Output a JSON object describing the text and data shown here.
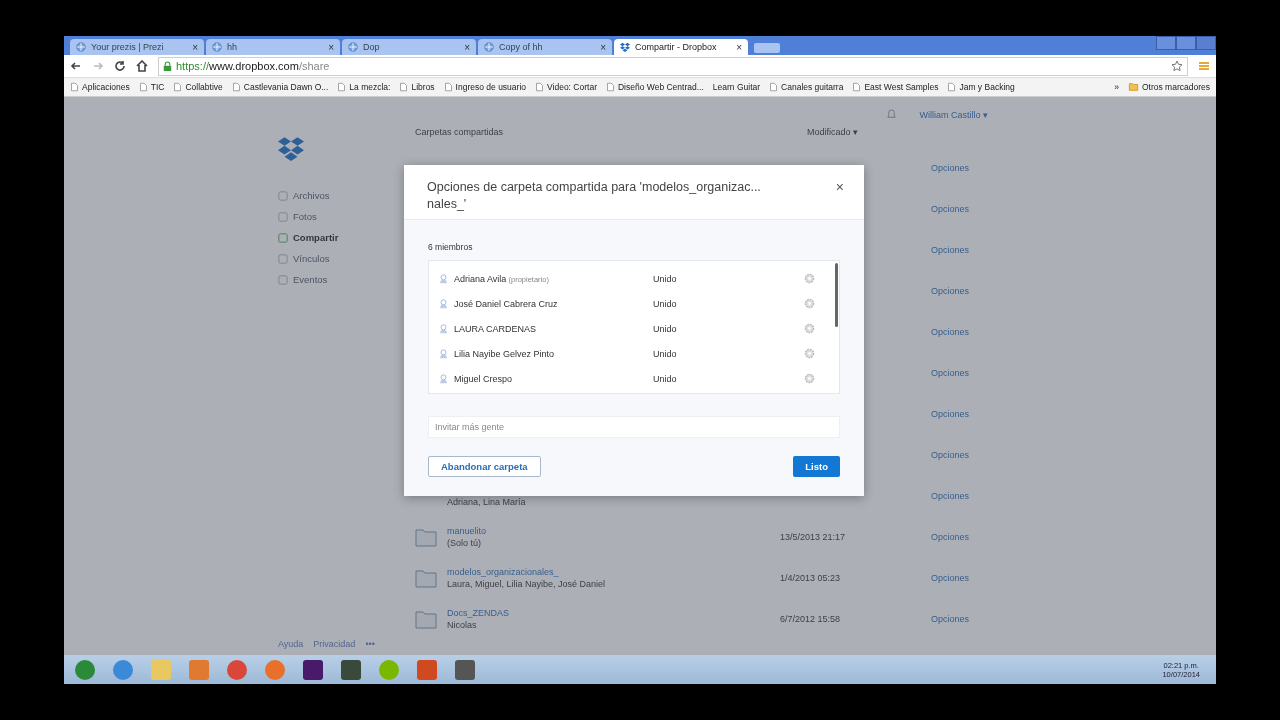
{
  "browser": {
    "tabs": [
      {
        "title": "Your prezis | Prezi",
        "selected": false
      },
      {
        "title": "hh",
        "selected": false
      },
      {
        "title": "Dop",
        "selected": false
      },
      {
        "title": "Copy of hh",
        "selected": false
      },
      {
        "title": "Compartir - Dropbox",
        "selected": true
      }
    ],
    "close_glyph": "×",
    "url": {
      "scheme": "https://",
      "host": "www.dropbox.com",
      "path": "/share"
    },
    "bookmarks": [
      {
        "label": "Aplicaciones",
        "has_icon": true
      },
      {
        "label": "TIC",
        "has_icon": true
      },
      {
        "label": "Collabtive",
        "has_icon": true
      },
      {
        "label": "Castlevania Dawn O...",
        "has_icon": true
      },
      {
        "label": "La mezcla:",
        "has_icon": true
      },
      {
        "label": "Libros",
        "has_icon": true
      },
      {
        "label": "Ingreso de usuario",
        "has_icon": true
      },
      {
        "label": "Video: Cortar",
        "has_icon": true
      },
      {
        "label": "Diseño Web Centrad...",
        "has_icon": true
      },
      {
        "label": "Learn Guitar",
        "has_icon": false
      },
      {
        "label": "Canales guitarra",
        "has_icon": true
      },
      {
        "label": "East West Samples",
        "has_icon": true
      },
      {
        "label": "Jam y Backing",
        "has_icon": true
      }
    ],
    "more": "»",
    "other_bookmarks": "Otros marcadores"
  },
  "page": {
    "header": {
      "column": "Carpetas compartidas",
      "sort": "Modificado",
      "user": "William Castillo",
      "caret": "▾"
    },
    "sidebar": [
      {
        "label": "Archivos",
        "selected": false
      },
      {
        "label": "Fotos",
        "selected": false
      },
      {
        "label": "Compartir",
        "selected": true
      },
      {
        "label": "Vínculos",
        "selected": false
      },
      {
        "label": "Eventos",
        "selected": false
      }
    ],
    "footer": [
      "Ayuda",
      "Privacidad",
      "•••"
    ],
    "rows": [
      {
        "action": "Opciones"
      },
      {
        "action": "Opciones"
      },
      {
        "action": "Opciones"
      },
      {
        "action": "Opciones"
      },
      {
        "action": "Opciones"
      },
      {
        "action": "Opciones"
      },
      {
        "action": "Opciones"
      },
      {
        "action": "Opciones"
      },
      {
        "members": "Adriana, Lina María",
        "action": "Opciones"
      },
      {
        "name": "manuelito",
        "members": "(Solo tú)",
        "date": "13/5/2013 21:17",
        "action": "Opciones"
      },
      {
        "name": "modelos_organizacionales_",
        "members": "Laura, Miguel, Lilia Nayibe, José Daniel",
        "date": "1/4/2013 05:23",
        "action": "Opciones"
      },
      {
        "name": "Docs_ZENDAS",
        "members": "Nicolas",
        "date": "6/7/2012 15:58",
        "action": "Opciones"
      }
    ]
  },
  "modal": {
    "title": "Opciones de carpeta compartida para 'modelos_organizac... nales_'",
    "close": "×",
    "count": "6 miembros",
    "members": [
      {
        "name": "Adriana Avila",
        "note": "(propietario)",
        "status": "Unido"
      },
      {
        "name": "José Daniel Cabrera Cruz",
        "status": "Unido"
      },
      {
        "name": "LAURA CARDENAS",
        "status": "Unido"
      },
      {
        "name": "Lilia Nayibe Gelvez Pinto",
        "status": "Unido"
      },
      {
        "name": "Miguel Crespo",
        "status": "Unido"
      }
    ],
    "invite": {
      "placeholder": "Invitar más gente"
    },
    "leave": "Abandonar carpeta",
    "done": "Listo"
  },
  "taskbar": {
    "time": "02:21 p.m.",
    "date": "10/07/2014"
  }
}
